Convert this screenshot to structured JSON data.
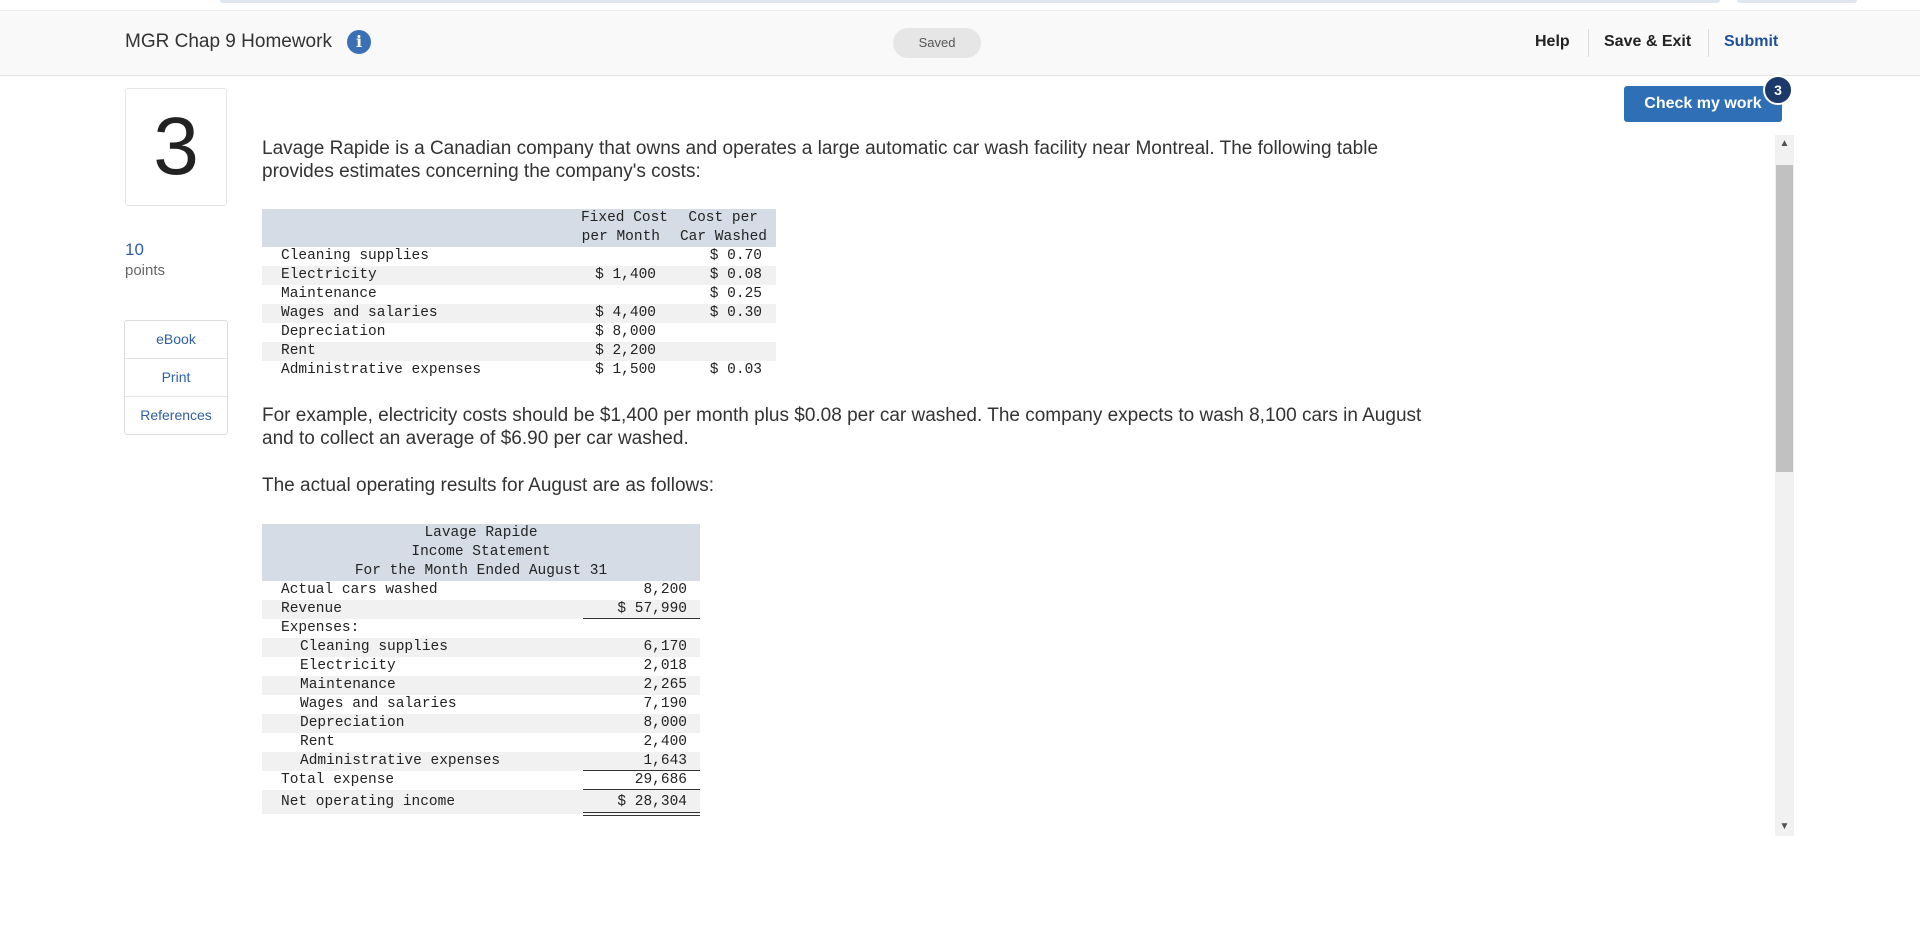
{
  "header": {
    "title": "MGR Chap 9 Homework",
    "info_icon": "info-icon",
    "status": "Saved",
    "help": "Help",
    "save_exit": "Save & Exit",
    "submit": "Submit"
  },
  "check": {
    "label": "Check my work",
    "badge": "3"
  },
  "question": {
    "number": "3",
    "points_value": "10",
    "points_label": "points",
    "links": [
      "eBook",
      "Print",
      "References"
    ]
  },
  "content": {
    "intro": "Lavage Rapide is a Canadian company that owns and operates a large automatic car wash facility near Montreal. The following table provides estimates concerning the company's costs:",
    "example": "For example, electricity costs should be $1,400 per month plus $0.08 per car washed. The company expects to wash 8,100 cars in August and to collect an average of $6.90 per car washed.",
    "actual_intro": "The actual operating results for August are as follows:"
  },
  "cost_table": {
    "headers": {
      "fixed_1": "Fixed Cost",
      "fixed_2": "per Month",
      "var_1": "Cost per",
      "var_2": "Car Washed"
    },
    "rows": [
      {
        "label": "Cleaning supplies",
        "fixed": "",
        "variable": "$ 0.70"
      },
      {
        "label": "Electricity",
        "fixed": "$ 1,400",
        "variable": "$ 0.08"
      },
      {
        "label": "Maintenance",
        "fixed": "",
        "variable": "$ 0.25"
      },
      {
        "label": "Wages and salaries",
        "fixed": "$ 4,400",
        "variable": "$ 0.30"
      },
      {
        "label": "Depreciation",
        "fixed": "$ 8,000",
        "variable": ""
      },
      {
        "label": "Rent",
        "fixed": "$ 2,200",
        "variable": ""
      },
      {
        "label": "Administrative expenses",
        "fixed": "$ 1,500",
        "variable": "$ 0.03"
      }
    ]
  },
  "income_statement": {
    "title_1": "Lavage Rapide",
    "title_2": "Income Statement",
    "title_3": "For the Month Ended August 31",
    "cars_label": "Actual cars washed",
    "cars_value": "8,200",
    "revenue_label": "Revenue",
    "revenue_value": "$ 57,990",
    "expenses_label": "Expenses:",
    "expenses": [
      {
        "label": "Cleaning supplies",
        "value": "6,170"
      },
      {
        "label": "Electricity",
        "value": "2,018"
      },
      {
        "label": "Maintenance",
        "value": "2,265"
      },
      {
        "label": "Wages and salaries",
        "value": "7,190"
      },
      {
        "label": "Depreciation",
        "value": "8,000"
      },
      {
        "label": "Rent",
        "value": "2,400"
      },
      {
        "label": "Administrative expenses",
        "value": "1,643"
      }
    ],
    "total_label": "Total expense",
    "total_value": "29,686",
    "net_label": "Net operating income",
    "net_value": "$ 28,304"
  }
}
